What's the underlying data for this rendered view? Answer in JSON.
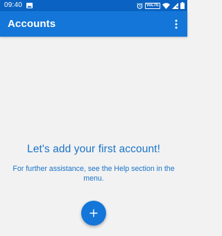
{
  "status_bar": {
    "time": "09:40",
    "volte": "VoLTE",
    "icons": [
      "photo-icon",
      "alarm-icon",
      "volte-icon",
      "wifi-icon",
      "signal-icon",
      "battery-icon"
    ]
  },
  "app_bar": {
    "title": "Accounts",
    "menu_icon": "more-vert-icon"
  },
  "empty_state": {
    "title": "Let's add your first account!",
    "help": "For further assistance, see the Help section in the menu."
  },
  "fab": {
    "icon": "plus-icon"
  },
  "colors": {
    "status_bar": "#0a63c2",
    "app_bar": "#1376d8",
    "text_accent": "#1a73c7",
    "background": "#f2f2f2"
  }
}
